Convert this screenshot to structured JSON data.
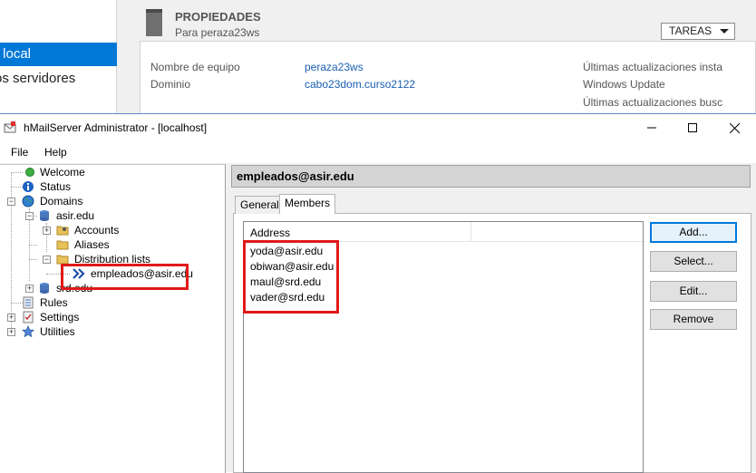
{
  "server_manager": {
    "nav": {
      "local_label": "r local",
      "all_servers_label": "os servidores"
    },
    "properties": {
      "title": "PROPIEDADES",
      "subtitle": "Para peraza23ws",
      "tasks_label": "TAREAS",
      "rows": [
        {
          "label": "Nombre de equipo",
          "value": "peraza23ws"
        },
        {
          "label": "Dominio",
          "value": "cabo23dom.curso2122"
        }
      ],
      "right_column": [
        "Últimas actualizaciones insta",
        "Windows Update",
        "Últimas actualizaciones busc"
      ]
    }
  },
  "window": {
    "title": "hMailServer Administrator - [localhost]",
    "menu": [
      "File",
      "Help"
    ],
    "tree": {
      "welcome": "Welcome",
      "status": "Status",
      "domains": "Domains",
      "domain1": "asir.edu",
      "accounts": "Accounts",
      "aliases": "Aliases",
      "distribution_lists": "Distribution lists",
      "selected_list": "empleados@asir.edu",
      "domain2": "srd.edu",
      "rules": "Rules",
      "settings": "Settings",
      "utilities": "Utilities"
    },
    "detail": {
      "header": "empleados@asir.edu",
      "tabs": [
        "General",
        "Members"
      ],
      "active_tab": "Members",
      "column_header": "Address",
      "members": [
        "yoda@asir.edu",
        "obiwan@asir.edu",
        "maul@srd.edu",
        "vader@srd.edu"
      ],
      "buttons": {
        "add": "Add...",
        "select": "Select...",
        "edit": "Edit...",
        "remove": "Remove"
      }
    }
  },
  "colors": {
    "accent": "#0078d7",
    "highlight_box": "#e01919"
  }
}
